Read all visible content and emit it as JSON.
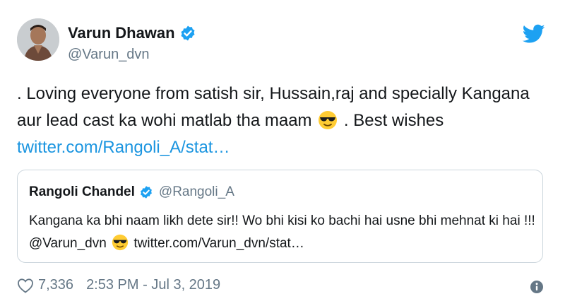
{
  "tweet": {
    "author_name": "Varun Dhawan",
    "author_handle": "@Varun_dvn",
    "text_part1": ". Loving everyone from satish sir, Hussain,raj and specially Kangana aur lead cast ka wohi matlab tha maam",
    "text_part2": ". Best wishes",
    "link": "twitter.com/Rangoli_A/stat…",
    "likes": "7,336",
    "timestamp": "2:53 PM - Jul 3, 2019"
  },
  "quoted": {
    "author_name": "Rangoli Chandel",
    "author_handle": "@Rangoli_A",
    "text_part1": "Kangana ka bhi naam likh dete sir!! Wo bhi kisi ko bachi hai usne bhi mehnat ki hai !!! @Varun_dvn",
    "link": "twitter.com/Varun_dvn/stat…"
  },
  "icons": {
    "verified": "verified-badge-icon",
    "twitter": "twitter-bird-icon",
    "emoji": "sunglasses-emoji-icon",
    "heart": "heart-icon",
    "info": "info-icon"
  },
  "colors": {
    "twitter_blue": "#1da1f2",
    "link_blue": "#1b95e0",
    "secondary_text": "#657786",
    "border": "#ccd6dd",
    "emoji_yellow": "#ffcc33"
  }
}
